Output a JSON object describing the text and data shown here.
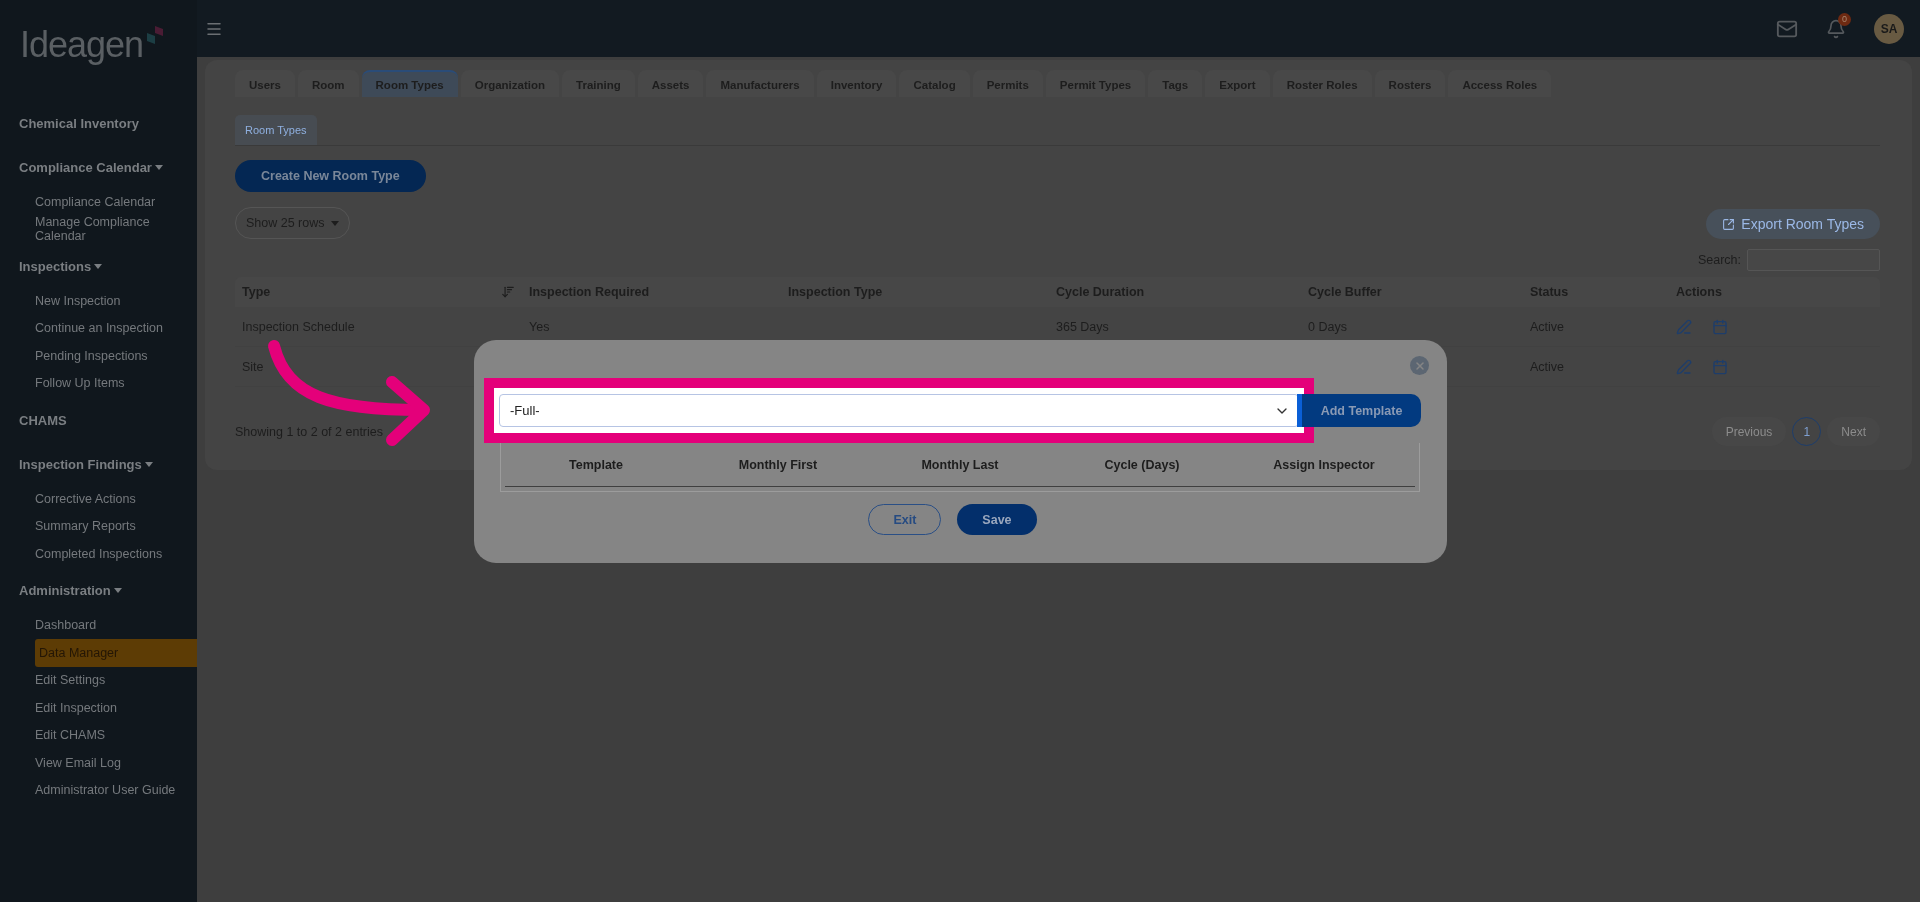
{
  "brand": {
    "name": "Ideagen"
  },
  "topbar": {
    "notification_count": "0",
    "avatar_initials": "SA"
  },
  "sidebar": {
    "items": [
      {
        "kind": "link",
        "label": "Chemical Inventory"
      },
      {
        "kind": "group",
        "label": "Compliance Calendar",
        "expanded": true,
        "children": [
          {
            "label": "Compliance Calendar",
            "selected": false
          },
          {
            "label": "Manage Compliance Calendar",
            "selected": false
          }
        ]
      },
      {
        "kind": "group",
        "label": "Inspections",
        "expanded": true,
        "children": [
          {
            "label": "New Inspection",
            "selected": false
          },
          {
            "label": "Continue an Inspection",
            "selected": false
          },
          {
            "label": "Pending Inspections",
            "selected": false
          },
          {
            "label": "Follow Up Items",
            "selected": false
          }
        ]
      },
      {
        "kind": "link",
        "label": "CHAMS"
      },
      {
        "kind": "group",
        "label": "Inspection Findings",
        "expanded": true,
        "children": [
          {
            "label": "Corrective Actions",
            "selected": false
          },
          {
            "label": "Summary Reports",
            "selected": false
          },
          {
            "label": "Completed Inspections",
            "selected": false
          }
        ]
      },
      {
        "kind": "group",
        "label": "Administration",
        "expanded": true,
        "children": [
          {
            "label": "Dashboard",
            "selected": false
          },
          {
            "label": "Data Manager",
            "selected": true
          },
          {
            "label": "Edit Settings",
            "selected": false
          },
          {
            "label": "Edit Inspection",
            "selected": false
          },
          {
            "label": "Edit CHAMS",
            "selected": false
          },
          {
            "label": "View Email Log",
            "selected": false
          },
          {
            "label": "Administrator User Guide",
            "selected": false
          }
        ]
      }
    ]
  },
  "tabs": [
    {
      "label": "Users",
      "selected": false
    },
    {
      "label": "Room",
      "selected": false
    },
    {
      "label": "Room Types",
      "selected": true
    },
    {
      "label": "Organization",
      "selected": false
    },
    {
      "label": "Training",
      "selected": false
    },
    {
      "label": "Assets",
      "selected": false
    },
    {
      "label": "Manufacturers",
      "selected": false
    },
    {
      "label": "Inventory",
      "selected": false
    },
    {
      "label": "Catalog",
      "selected": false
    },
    {
      "label": "Permits",
      "selected": false
    },
    {
      "label": "Permit Types",
      "selected": false
    },
    {
      "label": "Tags",
      "selected": false
    },
    {
      "label": "Export",
      "selected": false
    },
    {
      "label": "Roster Roles",
      "selected": false
    },
    {
      "label": "Rosters",
      "selected": false
    },
    {
      "label": "Access Roles",
      "selected": false
    }
  ],
  "subtabs": [
    {
      "label": "Room Types",
      "selected": true
    }
  ],
  "create_button": "Create New Room Type",
  "page_size": "Show 25 rows",
  "export_button": "Export Room Types",
  "search": {
    "label": "Search:"
  },
  "table": {
    "columns": [
      {
        "label": "Type",
        "sortable": true
      },
      {
        "label": "Inspection Required",
        "sortable": false
      },
      {
        "label": "Inspection Type",
        "sortable": false
      },
      {
        "label": "Cycle Duration",
        "sortable": false
      },
      {
        "label": "Cycle Buffer",
        "sortable": false
      },
      {
        "label": "Status",
        "sortable": false
      },
      {
        "label": "Actions",
        "sortable": false
      }
    ],
    "rows": [
      {
        "type": "Inspection Schedule",
        "inspection_required": "Yes",
        "cycle_duration": "365 Days",
        "cycle_buffer": "0 Days",
        "status": "Active"
      },
      {
        "type": "Site",
        "status": "Active"
      }
    ]
  },
  "info": "Showing 1 to 2 of 2 entries",
  "pagination": [
    {
      "label": "Previous",
      "disabled": true,
      "selected": false
    },
    {
      "label": "1",
      "disabled": false,
      "selected": true
    },
    {
      "label": "Next",
      "disabled": true,
      "selected": false
    }
  ],
  "modal": {
    "select_value": "-Full-",
    "add_button": "Add Template",
    "columns": [
      "Template",
      "Monthly First",
      "Monthly Last",
      "Cycle (Days)",
      "Assign Inspector"
    ],
    "buttons": [
      {
        "label": "Exit",
        "kind": "secondary"
      },
      {
        "label": "Save",
        "kind": "primary"
      }
    ]
  }
}
